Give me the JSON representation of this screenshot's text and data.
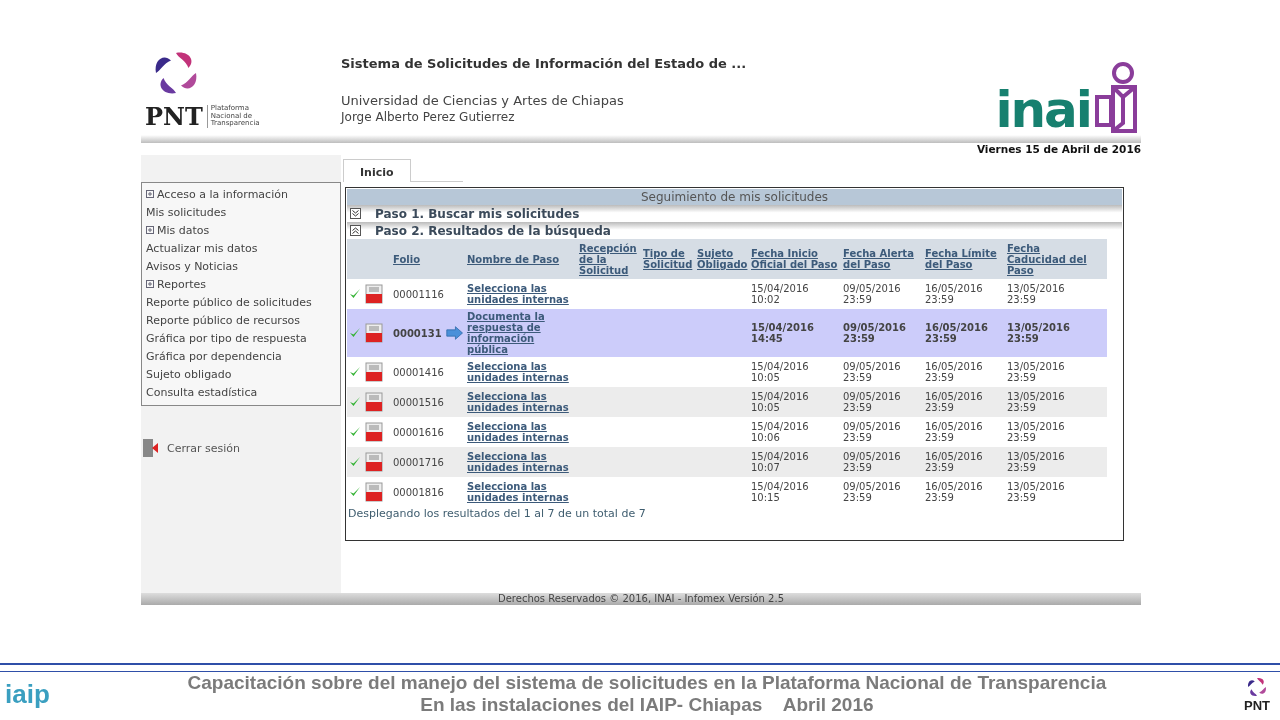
{
  "header": {
    "logo_title": "PNT",
    "logo_subtitle": "Plataforma Nacional de Transparencia",
    "system_title": "Sistema de Solicitudes de Información del Estado de ...",
    "institution": "Universidad de Ciencias y Artes de Chiapas",
    "user": "Jorge Alberto Perez Gutierrez",
    "brand": "inai",
    "date": "Viernes 15 de Abril de 2016"
  },
  "tabs": [
    {
      "label": "Inicio",
      "selected": true
    }
  ],
  "sidebar": {
    "items": [
      {
        "label": "Acceso a la información",
        "kind": "group"
      },
      {
        "label": "Mis solicitudes",
        "kind": "link"
      },
      {
        "label": "Mis datos",
        "kind": "group"
      },
      {
        "label": "Actualizar mis datos",
        "kind": "link"
      },
      {
        "label": "Avisos y Noticias",
        "kind": "link"
      },
      {
        "label": "Reportes",
        "kind": "group"
      },
      {
        "label": "Reporte público de solicitudes",
        "kind": "link"
      },
      {
        "label": "Reporte público de recursos",
        "kind": "link"
      },
      {
        "label": "Gráfica por tipo de respuesta",
        "kind": "link"
      },
      {
        "label": "Gráfica por dependencia",
        "kind": "link"
      },
      {
        "label": "Sujeto obligado",
        "kind": "link"
      },
      {
        "label": "Consulta estadística",
        "kind": "link"
      }
    ],
    "logout": "Cerrar sesión"
  },
  "panel": {
    "title": "Seguimiento de mis solicitudes",
    "steps": [
      {
        "label": "Paso 1. Buscar mis solicitudes",
        "expanded": false
      },
      {
        "label": "Paso 2. Resultados de la búsqueda",
        "expanded": true
      }
    ],
    "table": {
      "columns": [
        "Folio",
        "Nombre de Paso",
        "Recepción de la Solicitud",
        "Tipo de Solicitud",
        "Sujeto Obligado",
        "Fecha Inicio Oficial del Paso",
        "Fecha Alerta del Paso",
        "Fecha Límite del Paso",
        "Fecha Caducidad del Paso"
      ],
      "rows": [
        {
          "done": true,
          "selected": false,
          "pointer": false,
          "folio": "00001116",
          "step": "Selecciona las unidades internas",
          "dates": [
            "15/04/2016 10:02",
            "09/05/2016 23:59",
            "16/05/2016 23:59",
            "13/05/2016 23:59"
          ]
        },
        {
          "done": true,
          "selected": true,
          "pointer": true,
          "folio": "0000131",
          "step": "Documenta la respuesta de información pública",
          "dates": [
            "15/04/2016 14:45",
            "09/05/2016 23:59",
            "16/05/2016 23:59",
            "13/05/2016 23:59"
          ]
        },
        {
          "done": true,
          "selected": false,
          "pointer": false,
          "folio": "00001416",
          "step": "Selecciona las unidades internas",
          "dates": [
            "15/04/2016 10:05",
            "09/05/2016 23:59",
            "16/05/2016 23:59",
            "13/05/2016 23:59"
          ]
        },
        {
          "done": true,
          "selected": false,
          "pointer": false,
          "folio": "00001516",
          "step": "Selecciona las unidades internas",
          "dates": [
            "15/04/2016 10:05",
            "09/05/2016 23:59",
            "16/05/2016 23:59",
            "13/05/2016 23:59"
          ]
        },
        {
          "done": true,
          "selected": false,
          "pointer": false,
          "folio": "00001616",
          "step": "Selecciona las unidades internas",
          "dates": [
            "15/04/2016 10:06",
            "09/05/2016 23:59",
            "16/05/2016 23:59",
            "13/05/2016 23:59"
          ]
        },
        {
          "done": true,
          "selected": false,
          "pointer": false,
          "folio": "00001716",
          "step": "Selecciona las unidades internas",
          "dates": [
            "15/04/2016 10:07",
            "09/05/2016 23:59",
            "16/05/2016 23:59",
            "13/05/2016 23:59"
          ]
        },
        {
          "done": true,
          "selected": false,
          "pointer": false,
          "folio": "00001816",
          "step": "Selecciona las unidades internas",
          "dates": [
            "15/04/2016 10:15",
            "09/05/2016 23:59",
            "16/05/2016 23:59",
            "13/05/2016 23:59"
          ]
        }
      ]
    },
    "summary": "Desplegando los resultados del 1 al 7 de un total de 7"
  },
  "footer": "Derechos Reservados © 2016, INAI - Infomex Versión 2.5",
  "slide_footer": {
    "left_logo": "iaip",
    "lines": [
      "Capacitación sobre del manejo del sistema de solicitudes en la Plataforma Nacional de Transparencia",
      "En las instalaciones del IAIP- Chiapas    Abril 2016"
    ],
    "right_logo": "PNT"
  }
}
